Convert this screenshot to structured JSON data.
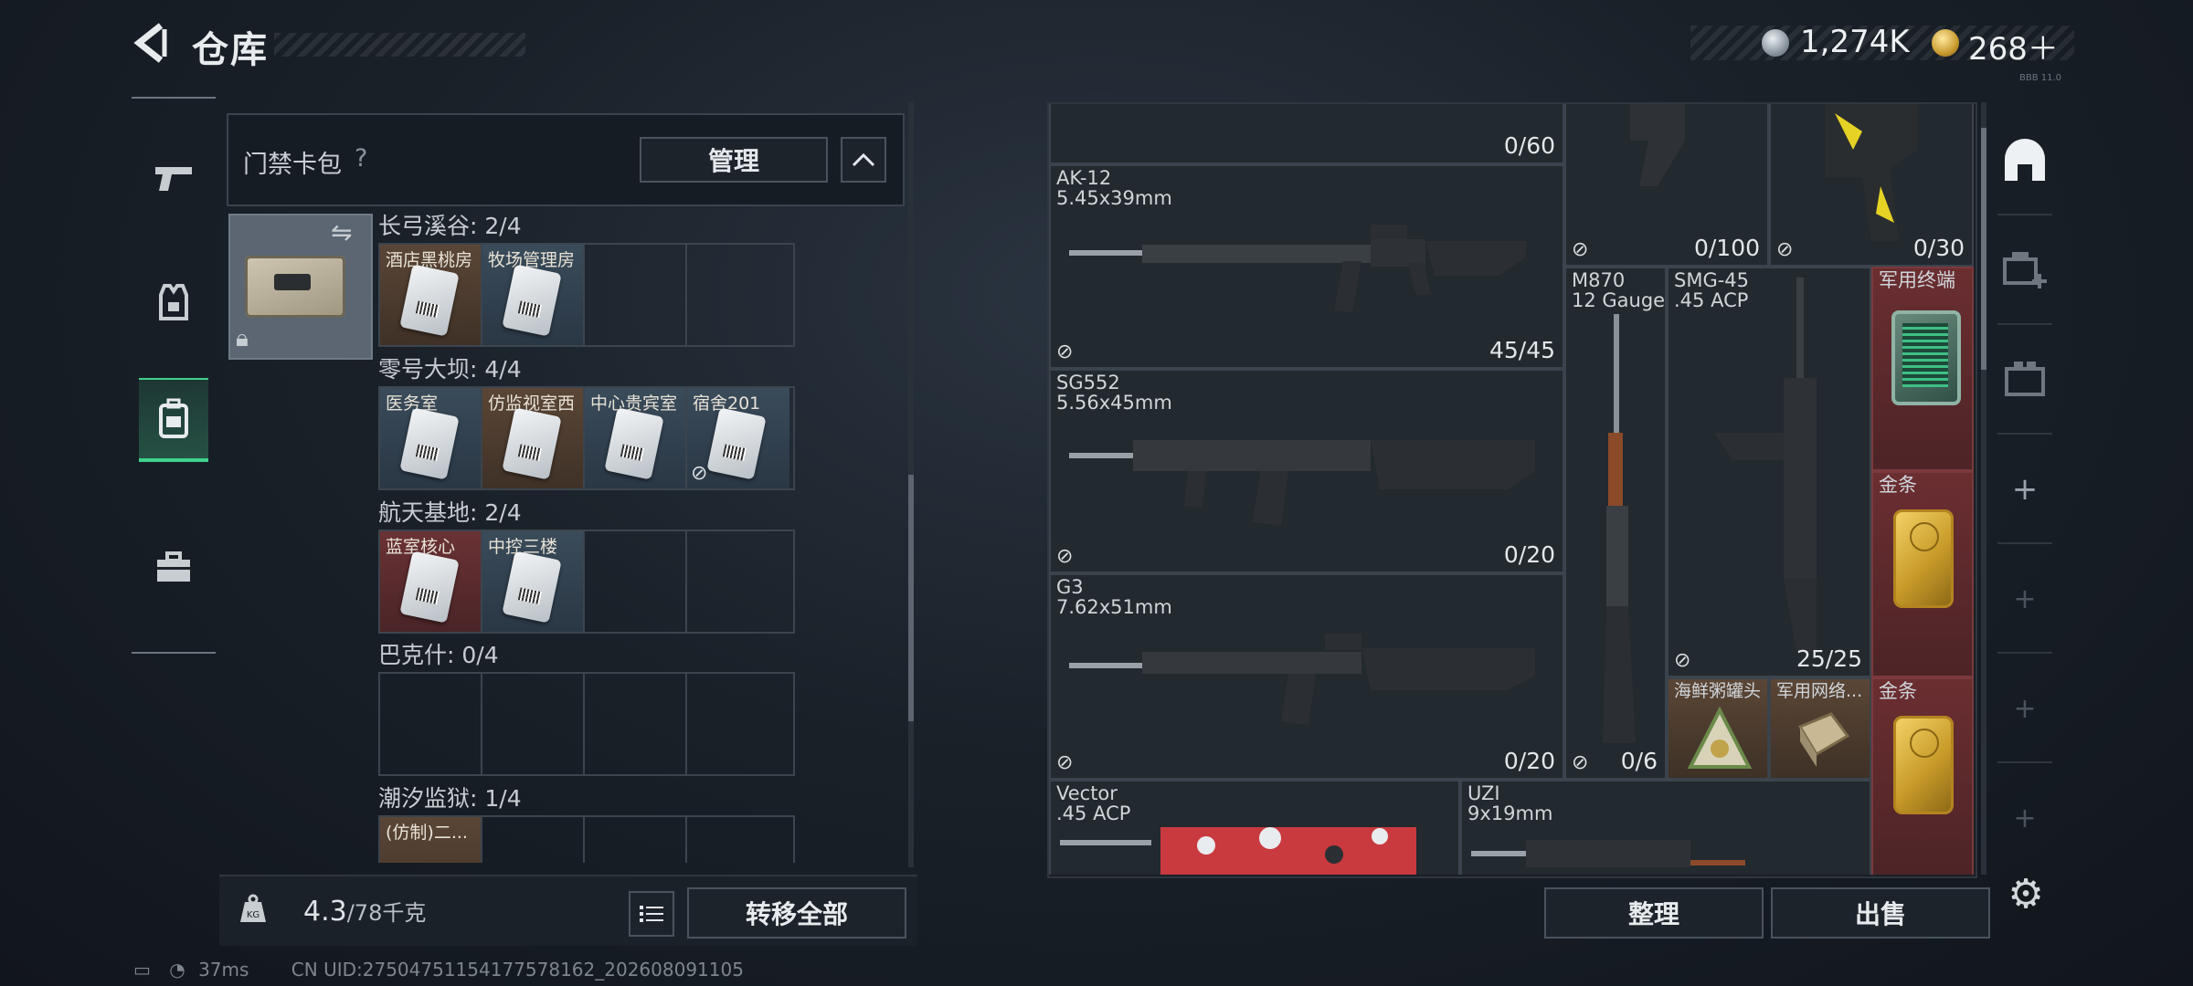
{
  "header": {
    "title": "仓库",
    "currency_1": "1,274K",
    "currency_2": "268＋",
    "tiny_tag": "BBB 11.0"
  },
  "nav": {
    "items": [
      "weapons-tab",
      "armor-tab",
      "backpack-tab",
      "case-tab"
    ],
    "active": "backpack-tab"
  },
  "card_pack": {
    "title": "门禁卡包",
    "help": "?",
    "manage_label": "管理",
    "groups": [
      {
        "name": "长弓溪谷: 2/4",
        "slots": [
          {
            "label": "酒店黑桃房",
            "color": "brown"
          },
          {
            "label": "牧场管理房",
            "color": "blue"
          },
          {
            "label": "",
            "color": ""
          },
          {
            "label": "",
            "color": ""
          }
        ]
      },
      {
        "name": "零号大坝: 4/4",
        "slots": [
          {
            "label": "医务室",
            "color": "blue"
          },
          {
            "label": "仿监视室西",
            "color": "brown"
          },
          {
            "label": "中心贵宾室",
            "color": "blue"
          },
          {
            "label": "宿舍201",
            "color": "blue"
          }
        ]
      },
      {
        "name": "航天基地: 2/4",
        "slots": [
          {
            "label": "蓝室核心",
            "color": "red"
          },
          {
            "label": "中控三楼",
            "color": "blue"
          },
          {
            "label": "",
            "color": ""
          },
          {
            "label": "",
            "color": ""
          }
        ]
      },
      {
        "name": "巴克什: 0/4",
        "slots": []
      },
      {
        "name": "潮汐监狱: 1/4",
        "slots": [
          {
            "label": "(仿制)二...",
            "color": "brown"
          }
        ]
      }
    ]
  },
  "footer_left": {
    "weight_value": "4.3",
    "weight_unit": "/78千克",
    "transfer_all_label": "转移全部"
  },
  "status": {
    "ping": "37ms",
    "uid": "CN UID:27504751154177578162_202608091105"
  },
  "stash": {
    "items": {
      "top_gun_count": "0/60",
      "ak12_name": "AK-12\n5.45x39mm",
      "ak12_count": "45/45",
      "m870_top_count": "0/100",
      "gold_gun_count": "0/30",
      "m870_name": "M870\n12 Gauge",
      "smg45_name": "SMG-45\n.45 ACP",
      "terminal_name": "军用终端",
      "sg552_name": "SG552\n5.56x45mm",
      "sg552_count": "0/20",
      "gold1_name": "金条",
      "smg45_count": "25/25",
      "g3_name": "G3\n7.62x51mm",
      "g3_count": "0/20",
      "m870_count": "0/6",
      "seafood_name": "海鲜粥罐头",
      "mil_network_name": "军用网络...",
      "gold2_name": "金条",
      "vector_name": "Vector\n.45 ACP",
      "uzi_name": "UZI\n9x19mm"
    },
    "sort_label": "整理",
    "sell_label": "出售"
  },
  "colors": {
    "accent": "#3fd18b",
    "panel": "#1a1f25",
    "border": "#3b434c"
  }
}
